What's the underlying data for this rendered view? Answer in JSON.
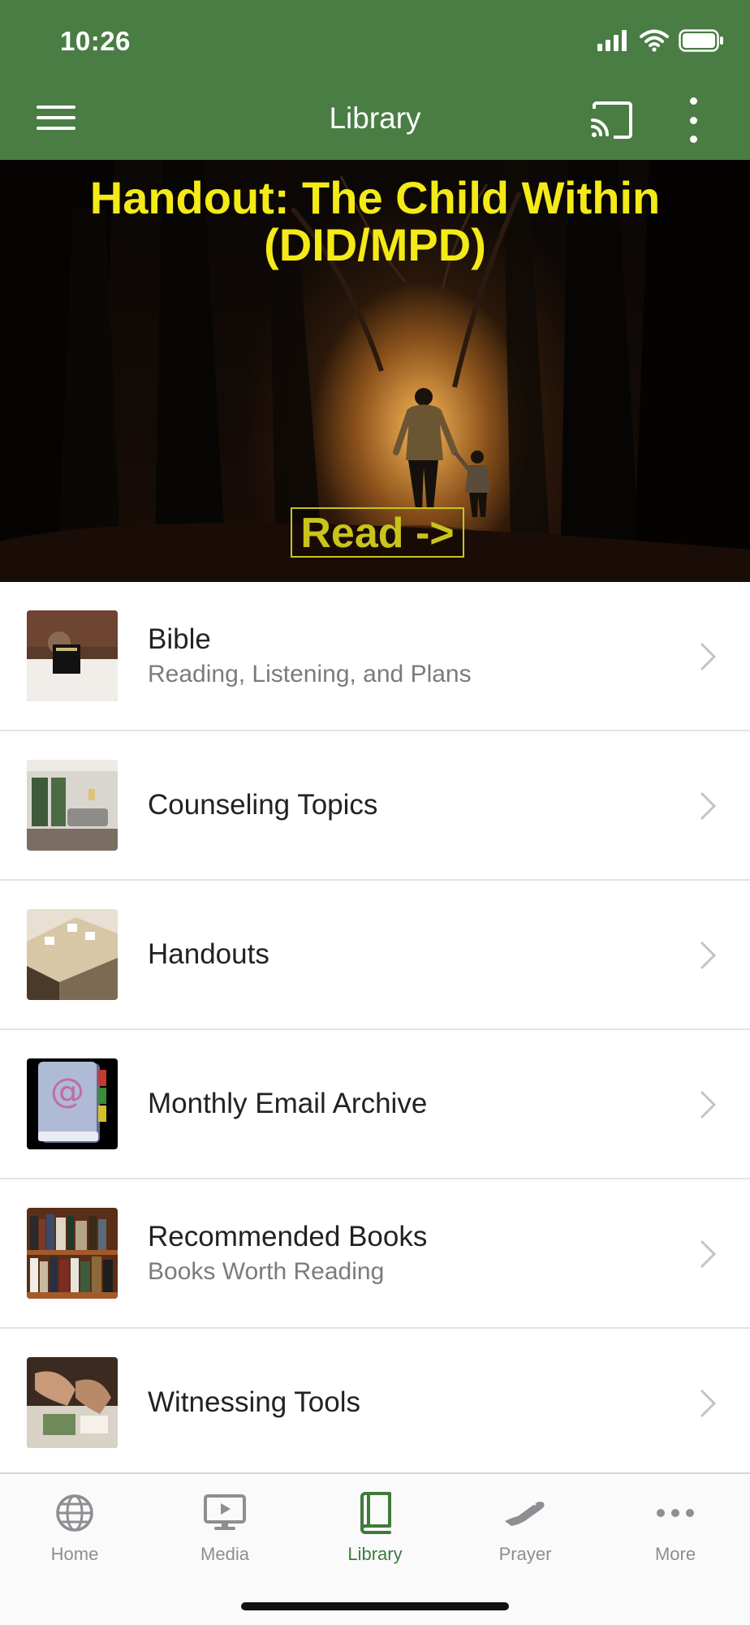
{
  "status_bar": {
    "time": "10:26"
  },
  "header": {
    "title": "Library",
    "menu_icon": "menu-icon",
    "cast_icon": "cast-icon",
    "more_icon": "more-vertical-icon"
  },
  "hero": {
    "title": "Handout: The Child Within (DID/MPD)",
    "button_label": "Read ->",
    "title_color": "#f4ea17"
  },
  "list": [
    {
      "title": "Bible",
      "subtitle": "Reading, Listening, and Plans"
    },
    {
      "title": "Counseling Topics",
      "subtitle": ""
    },
    {
      "title": "Handouts",
      "subtitle": ""
    },
    {
      "title": "Monthly Email Archive",
      "subtitle": ""
    },
    {
      "title": "Recommended Books",
      "subtitle": "Books Worth Reading"
    },
    {
      "title": "Witnessing Tools",
      "subtitle": ""
    }
  ],
  "tabs": [
    {
      "label": "Home",
      "icon": "globe-icon"
    },
    {
      "label": "Media",
      "icon": "monitor-play-icon"
    },
    {
      "label": "Library",
      "icon": "book-icon",
      "active": true
    },
    {
      "label": "Prayer",
      "icon": "praying-hands-icon"
    },
    {
      "label": "More",
      "icon": "more-horizontal-icon"
    }
  ],
  "colors": {
    "brand": "#4a7d44",
    "active_tab": "#3f7a3b"
  }
}
